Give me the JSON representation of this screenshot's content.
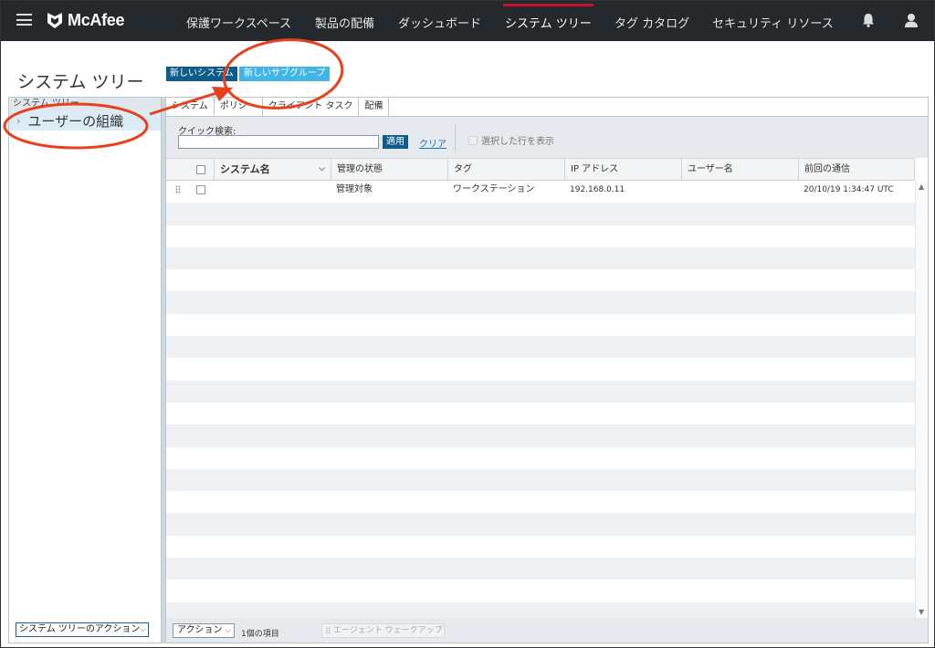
{
  "topnav": {
    "brand": "McAfee",
    "items": [
      {
        "label": "保護ワークスペース"
      },
      {
        "label": "製品の配備"
      },
      {
        "label": "ダッシュボード"
      },
      {
        "label": "システム ツリー",
        "active": true
      },
      {
        "label": "タグ カタログ"
      },
      {
        "label": "セキュリティ リソース"
      }
    ],
    "icons": [
      "menu-icon",
      "bell-icon",
      "user-icon"
    ],
    "accent": "#c8102e",
    "background": "#24292e"
  },
  "page": {
    "title": "システム ツリー",
    "new_system_label": "新しいシステム",
    "new_subgroup_label": "新しいサブグループ"
  },
  "tree": {
    "header": "システム ツリー",
    "root_label": "ユーザーの組織",
    "actions_label": "システム ツリーのアクション"
  },
  "tabs": [
    {
      "label": "システム",
      "active": true
    },
    {
      "label": "ポリシー"
    },
    {
      "label": "クライアント タスク"
    },
    {
      "label": "配備"
    }
  ],
  "filter": {
    "quick_search_label": "クイック検索:",
    "quick_search_value": "",
    "apply_label": "適用",
    "clear_label": "クリア",
    "show_selected_label": "選択した行を表示"
  },
  "table": {
    "columns": [
      "システム名",
      "管理の状態",
      "タグ",
      "IP アドレス",
      "ユーザー名",
      "前回の通信"
    ],
    "rows": [
      {
        "system_name": "",
        "managed_state": "管理対象",
        "tag": "ワークステーション",
        "ip": "192.168.0.11",
        "user": "",
        "last_comm": "20/10/19 1:34:47 UTC"
      }
    ]
  },
  "bottom": {
    "actions_label": "アクション",
    "count_label": "1個の項目",
    "wakeup_label": "エージェント ウェークアップ"
  },
  "colors": {
    "primary_button": "#0d5c8a",
    "highlight_button": "#41b6e6",
    "annotation": "#e8401c",
    "tree_selected": "#dcecf7"
  }
}
